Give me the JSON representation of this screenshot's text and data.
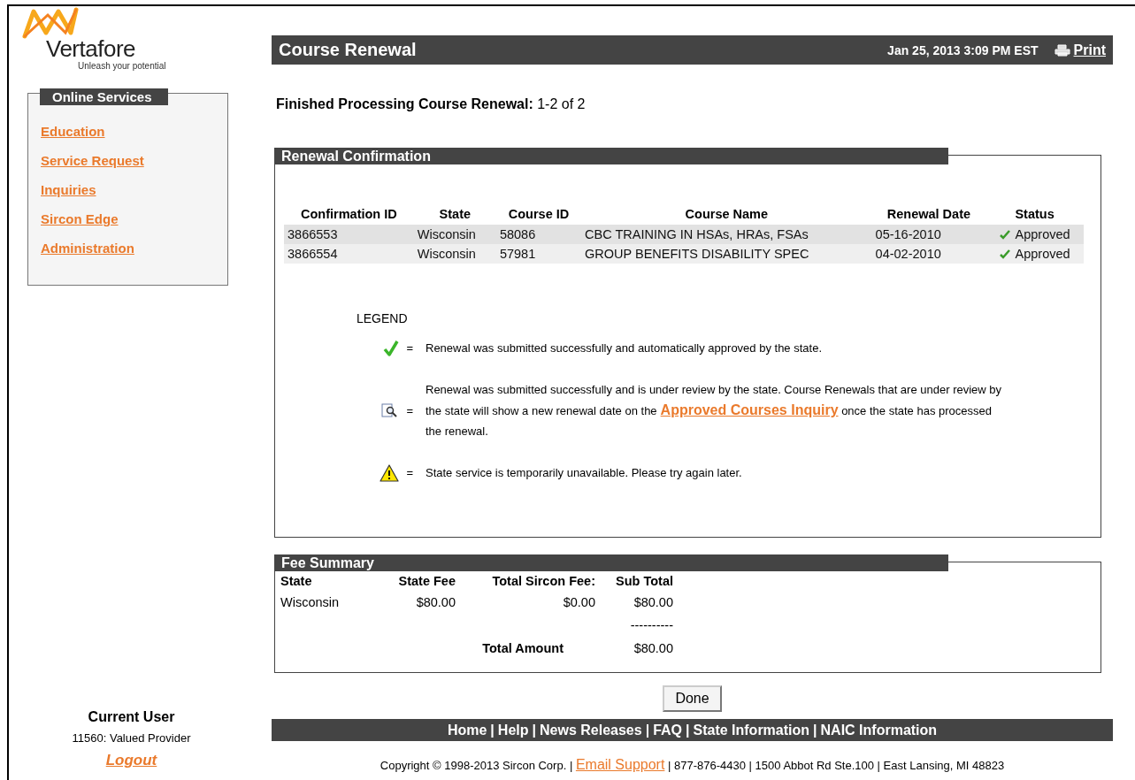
{
  "brand": {
    "name": "Vertafore",
    "tagline": "Unleash your potential"
  },
  "sidebar": {
    "title": "Online Services",
    "items": [
      {
        "label": "Education"
      },
      {
        "label": "Service Request"
      },
      {
        "label": "Inquiries"
      },
      {
        "label": "Sircon Edge"
      },
      {
        "label": "Administration"
      }
    ]
  },
  "current_user": {
    "title": "Current User",
    "user": "11560: Valued Provider",
    "logout": "Logout"
  },
  "header": {
    "title": "Course Renewal",
    "datetime": "Jan 25, 2013 3:09 PM EST",
    "print": "Print"
  },
  "summary": {
    "label": "Finished Processing Course Renewal:",
    "value": "1-2 of 2"
  },
  "confirmation": {
    "title": "Renewal Confirmation",
    "columns": [
      "Confirmation ID",
      "State",
      "Course ID",
      "Course Name",
      "Renewal Date",
      "Status"
    ],
    "rows": [
      {
        "confirmation_id": "3866553",
        "state": "Wisconsin",
        "course_id": "58086",
        "course_name": "CBC TRAINING IN HSAs, HRAs, FSAs",
        "renewal_date": "05-16-2010",
        "status": "Approved",
        "kind": "approved"
      },
      {
        "confirmation_id": "3866554",
        "state": "Wisconsin",
        "course_id": "57981",
        "course_name": "GROUP BENEFITS DISABILITY SPEC",
        "renewal_date": "04-02-2010",
        "status": "Approved",
        "kind": "approved"
      }
    ],
    "legend": {
      "title": "LEGEND",
      "items": [
        {
          "kind": "approved",
          "equals": "=",
          "text": "Renewal was submitted successfully and automatically approved by the state."
        },
        {
          "kind": "review",
          "equals": "=",
          "text": "Renewal was submitted successfully and is under review by the state. Course Renewals that are under review by the state will show a new renewal date on the",
          "link": "Approved Courses Inquiry",
          "text_after": "once the state has processed the renewal."
        },
        {
          "kind": "warning",
          "equals": "=",
          "text": "State service is temporarily unavailable. Please try again later."
        }
      ]
    }
  },
  "fee_summary": {
    "title": "Fee Summary",
    "columns": [
      "State",
      "State Fee",
      "Total Sircon Fee:",
      "Sub Total"
    ],
    "rows": [
      {
        "state": "Wisconsin",
        "state_fee": "$80.00",
        "sircon_fee": "$0.00",
        "sub_total": "$80.00"
      }
    ],
    "separator": "----------",
    "total_label": "Total Amount",
    "total": "$80.00"
  },
  "done_button": "Done",
  "footer": {
    "links": [
      {
        "label": "Home"
      },
      {
        "label": "Help"
      },
      {
        "label": "News Releases"
      },
      {
        "label": "FAQ"
      },
      {
        "label": "State Information"
      },
      {
        "label": "NAIC Information"
      }
    ],
    "separator": "|",
    "copyright": "Copyright © 1998-2013 Sircon Corp. |",
    "email": "Email Support",
    "contact": "| 877-876-4430 | 1500 Abbot Rd Ste.100 | East Lansing, MI 48823"
  }
}
